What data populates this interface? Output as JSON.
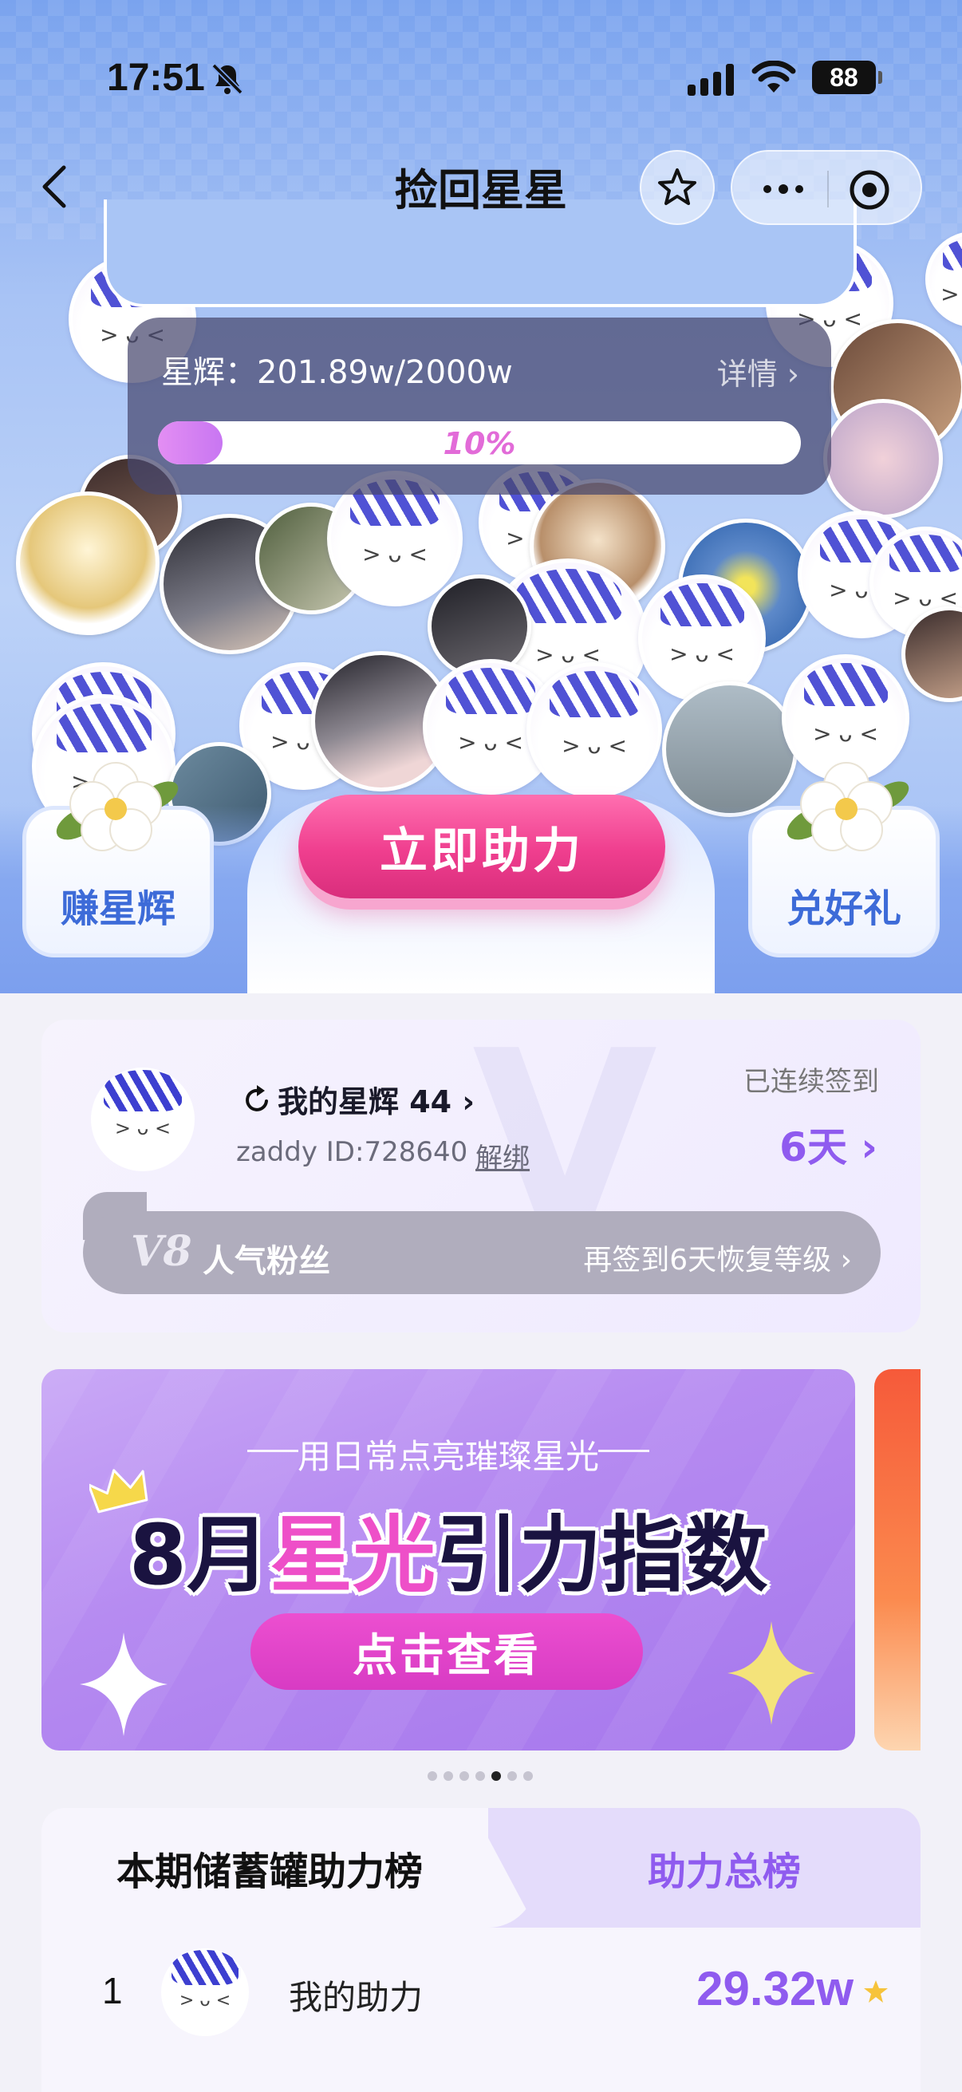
{
  "status_bar": {
    "time": "17:51",
    "battery": "88",
    "icons": [
      "bell-mute-icon",
      "signal-icon",
      "wifi-icon",
      "battery-icon"
    ]
  },
  "nav": {
    "title": "捡回星星",
    "icons": [
      "back-icon",
      "star-icon",
      "more-icon",
      "target-icon"
    ]
  },
  "progress": {
    "label": "星辉：201.89w/2000w",
    "detail": "详情",
    "percent_text": "10%",
    "fraction": 0.1
  },
  "actions": {
    "earn": "赚星辉",
    "redeem": "兑好礼",
    "help_now": "立即助力"
  },
  "checkin": {
    "stars": "我的星辉 44",
    "user_id": "zaddy ID:728640",
    "unbind": "解绑",
    "streak_label": "已连续签到",
    "streak_days": "6天",
    "level_badge": "V8",
    "level_name": "人气粉丝",
    "level_hint": "再签到6天恢复等级"
  },
  "banner": {
    "subtitle": "用日常点亮璀璨星光",
    "title_prefix": "8月",
    "title_highlight": "星光",
    "title_suffix": "引力指数",
    "button": "点击查看",
    "pager_total": 7,
    "pager_active": 5
  },
  "board": {
    "tabs": [
      "本期储蓄罐助力榜",
      "助力总榜"
    ],
    "rows": [
      {
        "rank": "1",
        "name": "我的助力",
        "score": "29.32w"
      }
    ]
  },
  "colors": {
    "accent_purple": "#8f5bef",
    "cta_pink": "#ef3e8e",
    "hero_blue": "#7aa3ee"
  }
}
